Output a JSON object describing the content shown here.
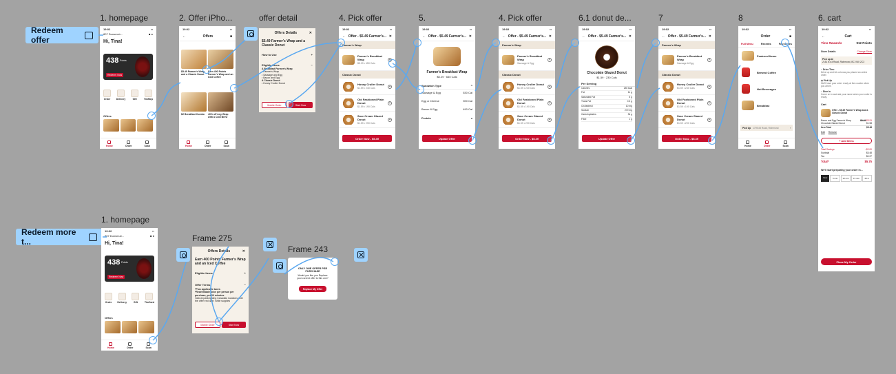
{
  "flows": {
    "redeem_offer": "Redeem offer",
    "redeem_more": "Redeem more t..."
  },
  "frame_labels": {
    "homepage": "1. homepage",
    "offer_iphone": "2. Offer iPho...",
    "offer_detail": "offer detail",
    "pick_offer_a": "4. Pick offer",
    "step5": "5.",
    "pick_offer_b": "4. Pick offer",
    "donut_detail": "6.1 donut de...",
    "step7": "7",
    "step8": "8",
    "cart": "6. cart",
    "homepage2": "1. homepage",
    "frame275": "Frame 275",
    "frame243": "Frame 243"
  },
  "home": {
    "time": "19:02",
    "store": "807 Dunsmuir...",
    "greeting": "Hi, Tina!",
    "points": "438",
    "points_label": "Points",
    "rewards_btn": "Redeem Now",
    "tab_order": "Order",
    "tab_delivery": "Delivery",
    "tab_gift": "Gift",
    "tab_timmep": "TimMep",
    "tab_timcard": "TimCard",
    "offers_label": "Offers",
    "nav_home": "Home",
    "nav_order": "Order",
    "nav_scan": "Scan"
  },
  "offers_page": {
    "title": "Offers",
    "card1": "$5.49 Farmer's Wrap and a Classic Donut",
    "card2": "Earn 400 Points Farmer's Wrap and an Iced Coffee",
    "card3": "$2 Breakfast Combo",
    "card4": "40% off Any Wrap with a Cold Brew"
  },
  "offer_detail": {
    "title": "Offers Details",
    "heading": "$5.49 Farmer's Wrap and a Classic Donut",
    "how_to_use": "How to Use",
    "eligible_items": "Eligible Items",
    "e1": "A Breakfast Farmer's Wrap",
    "e2": "• Farmer's Wrap",
    "e3": "• Sausage and Egg",
    "e4": "• Bacon and Egg",
    "e5": "A Classic Donut",
    "e6": "• Honey Cruller Donut",
    "mobile_order": "Mobile Order",
    "start_now": "Start Now"
  },
  "pick": {
    "header": "Offer - $5.49 Farmer's...",
    "farmers_wrap": "Farmer's Wrap",
    "item1": "Farmer's Breakfast Wrap",
    "item1_sub": "$5.29 • 450 Cals",
    "classic_donut": "Classic Donut",
    "item2": "Honey Cruller Donut",
    "item2_sub": "$1.59 • 240 Cals",
    "item3": "Old Fashioned Plain Donut",
    "item3_sub": "$1.59 • 190 Cals",
    "item4": "Sour Cream Glazed Donut",
    "item4_sub": "$1.59 • 290 Cals",
    "order_now": "Order Now - $5.49"
  },
  "wrap_detail": {
    "name": "Farmer's Breakfast Wrap",
    "price": "$5.29 · 640 Cals",
    "sandwich_type": "Sandwich Type",
    "opt1": "Sausage & Egg",
    "opt1_cal": "530 Cal",
    "opt2": "Egg & Cheese",
    "opt2_cal": "390 Cal",
    "opt3": "Bacon & Egg",
    "opt3_cal": "490 Cal",
    "protein": "Protein",
    "update": "Update Offer"
  },
  "donut_detail": {
    "name": "Chocolate Glazed Donut",
    "price": "$1.59 · 230 Cals",
    "per_serving": "Per Serving",
    "n1": "Calories",
    "v1": "230 kcal",
    "n2": "Fat",
    "v2": "11 g",
    "n3": "Saturated Fat",
    "v3": "5 g",
    "n4": "Trans Fat",
    "v4": "0.3 g",
    "n5": "Cholesterol",
    "v5": "10 mg",
    "n6": "Sodium",
    "v6": "270 mg",
    "n7": "Carbohydrates",
    "v7": "34 g",
    "n8": "Fibre",
    "v8": "1 g",
    "update": "Update Offer"
  },
  "step8": {
    "title": "Order",
    "tab1": "Full Menu",
    "tab2": "Recents",
    "tab3": "Favourites",
    "c1": "Featured Items",
    "c2": "Brewed Coffee",
    "c3": "Hot Beverages",
    "c4": "Breakfast",
    "pickup": "Pick Up",
    "address": "1795 #3 Road, Richmond"
  },
  "cart": {
    "title": "Cart",
    "brand": "Tims Rewards",
    "points": "912 Points",
    "store_details": "Store Details",
    "change_store": "Change Store",
    "pickup_at": "Pick up at",
    "pickup_addr": "2151 B #3 Road, Richmond, BC V6X 2C3",
    "drive_thru": "Drive Thru",
    "drive_thru_sub": "Drive up and let us know you placed an online order.",
    "pick_up": "Pick Up",
    "pick_up_sub": "We'll have your order ready at the counter when you arrive.",
    "dine_in": "Dine In",
    "dine_in_sub": "Come on in and ask your name when your order is ready.",
    "cart_label": "Cart",
    "offer_name": "Offer - $5.49 Farmer's Wrap and a Classic Donut",
    "line1": "Bacon and Egg Farmer's Wrap",
    "line1_price": "$5.19",
    "line1_sale": "$3.91",
    "line2": "Chocolate Glazed Donut",
    "line2_price": "$1.58",
    "item_total": "Item Total",
    "item_total_val": "$5.48",
    "edit": "Edit",
    "remove": "Remove",
    "add_items": "+ Add Items",
    "savings": "Total Savings",
    "savings_val": "- $2.00",
    "subtotal": "Subtotal",
    "subtotal_val": "$5.48",
    "tax": "Tax",
    "tax_val": "$0.27",
    "total": "Total*",
    "total_val": "$5.75",
    "prep": "We'll start preparing your order in...",
    "t1": "Now",
    "t2": "5 min",
    "t3": "10 min",
    "t4": "15 min",
    "t5": "20 m",
    "place": "Place My Order"
  },
  "frame275": {
    "title": "Offers Details",
    "heading": "Earn 400 Points Farmer's Wrap and an Iced Coffee",
    "eligible": "Eligible Items",
    "terms": "Offer Terms",
    "t1": "*Plus applicable taxes",
    "t2": "*Redeemable once per person per purchase, per 30 minutes.",
    "t3": "Valid at participating Canadian locations until the offer end date, while supplies",
    "mobile_order": "Mobile Order",
    "start_now": "Start Now"
  },
  "frame243": {
    "heading": "ONLY ONE OFFER PER PURCHASE",
    "body": "Would you like you Replace your current offer to this one?",
    "btn": "Replace My Offer"
  },
  "colors": {
    "canvas": "#a3a3a3",
    "brand_red": "#c8102e",
    "flow_blue": "#9fd3ff",
    "link_blue": "#5aa8f0",
    "cream": "#f6f1e9"
  }
}
